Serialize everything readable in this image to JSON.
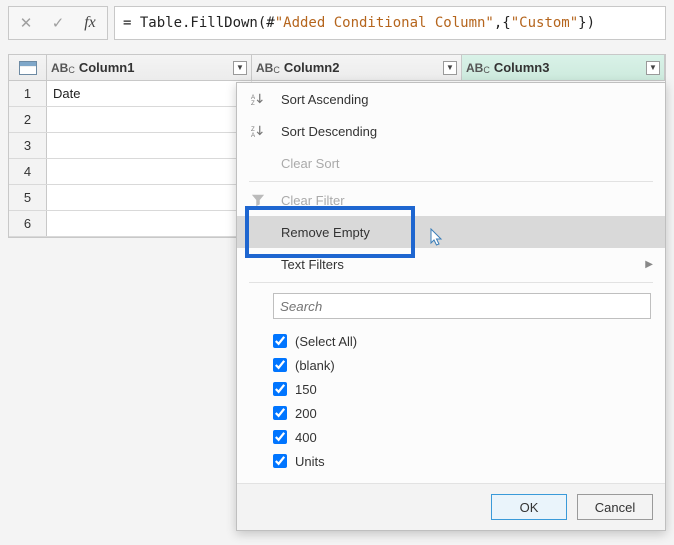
{
  "formula": {
    "prefix": "= Table.FillDown(#",
    "str1": "\"Added Conditional Column\"",
    "mid": ",{",
    "str2": "\"Custom\"",
    "suffix": "})"
  },
  "columns": {
    "c1": "Column1",
    "c2": "Column2",
    "c3": "Column3"
  },
  "rows": {
    "r1": "1",
    "r2": "2",
    "r3": "3",
    "r4": "4",
    "r5": "5",
    "r6": "6",
    "cell_1_1": "Date"
  },
  "menu": {
    "sort_asc": "Sort Ascending",
    "sort_desc": "Sort Descending",
    "clear_sort": "Clear Sort",
    "clear_filter": "Clear Filter",
    "remove_empty": "Remove Empty",
    "text_filters": "Text Filters"
  },
  "search": {
    "placeholder": "Search"
  },
  "checks": {
    "select_all": "(Select All)",
    "blank": "(blank)",
    "v150": "150",
    "v200": "200",
    "v400": "400",
    "units": "Units"
  },
  "buttons": {
    "ok": "OK",
    "cancel": "Cancel"
  }
}
